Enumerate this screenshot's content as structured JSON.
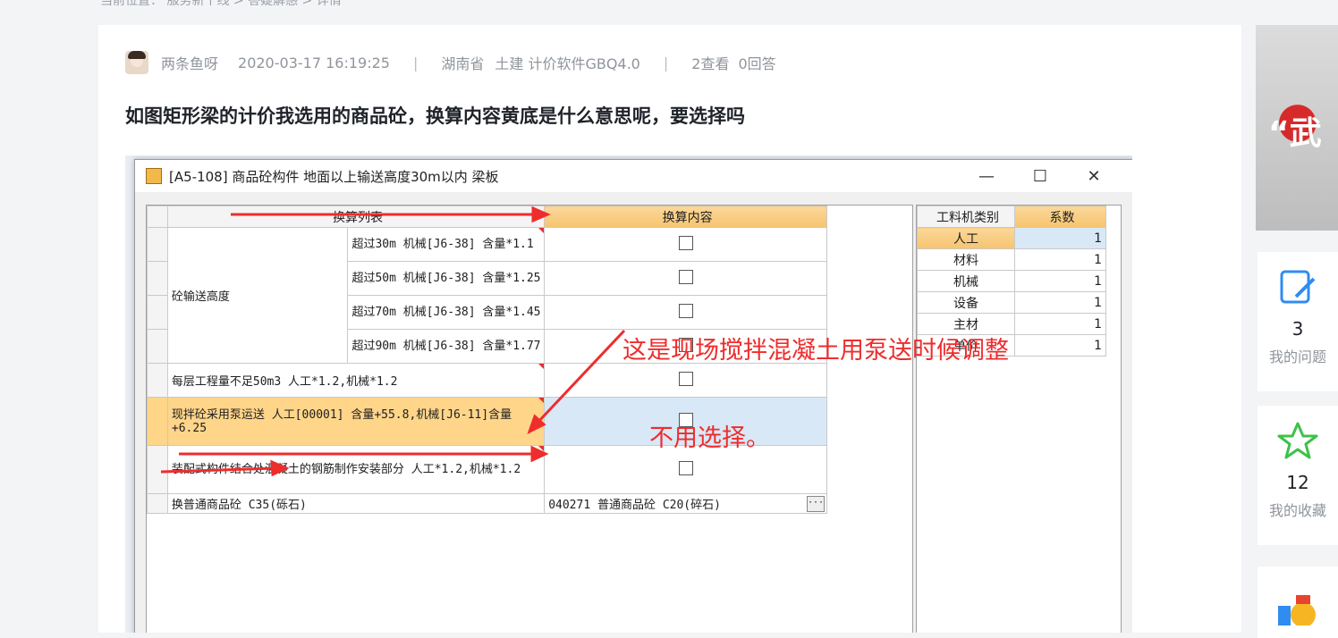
{
  "breadcrumb": "当前位置：  服务新干线 >  答疑解惑 >  详情",
  "question": {
    "author": "两条鱼呀",
    "datetime": "2020-03-17 16:19:25",
    "separator": "|",
    "region": "湖南省",
    "category": "土建 计价软件GBQ4.0",
    "views": "2查看",
    "answers": "0回答",
    "title": "如图矩形梁的计价我选用的商品砼，换算内容黄底是什么意思呢，要选择吗"
  },
  "dialog": {
    "title": "[A5-108]  商品砼构件 地面以上输送高度30m以内 梁板",
    "min_glyph": "—",
    "max_glyph": "☐",
    "close_glyph": "✕",
    "left_headers": [
      "换算列表",
      "换算内容"
    ],
    "group_label": "砼输送高度",
    "height_rows": [
      "超过30m 机械[J6-38] 含量*1.1",
      "超过50m 机械[J6-38] 含量*1.25",
      "超过70m 机械[J6-38] 含量*1.45",
      "超过90m 机械[J6-38] 含量*1.77"
    ],
    "row_floor": "每层工程量不足50m3 人工*1.2,机械*1.2",
    "row_pump": "现拌砼采用泵运送 人工[00001] 含量+55.8,机械[J6-11]含量+6.25",
    "row_assembly": "装配式构件结合处混凝土的钢筋制作安装部分 人工*1.2,机械*1.2",
    "row_replace_label": "换普通商品砼 C35(砾石)",
    "row_replace_value": "040271  普通商品砼 C20(碎石)",
    "ellipsis": "···",
    "right_headers": [
      "工料机类别",
      "系数"
    ],
    "right_rows": [
      {
        "name": "人工",
        "coef": "1"
      },
      {
        "name": "材料",
        "coef": "1"
      },
      {
        "name": "机械",
        "coef": "1"
      },
      {
        "name": "设备",
        "coef": "1"
      },
      {
        "name": "主材",
        "coef": "1"
      },
      {
        "name": "单价",
        "coef": "1"
      }
    ]
  },
  "annotations": {
    "line1": "这是现场搅拌混凝土用泵送时候调整",
    "line2": "不用选择。",
    "color": "#ee2d2d"
  },
  "sidebar": {
    "ad_text": "“武",
    "my_questions_count": "3",
    "my_questions_label": "我的问题",
    "my_favorites_count": "12",
    "my_favorites_label": "我的收藏"
  }
}
